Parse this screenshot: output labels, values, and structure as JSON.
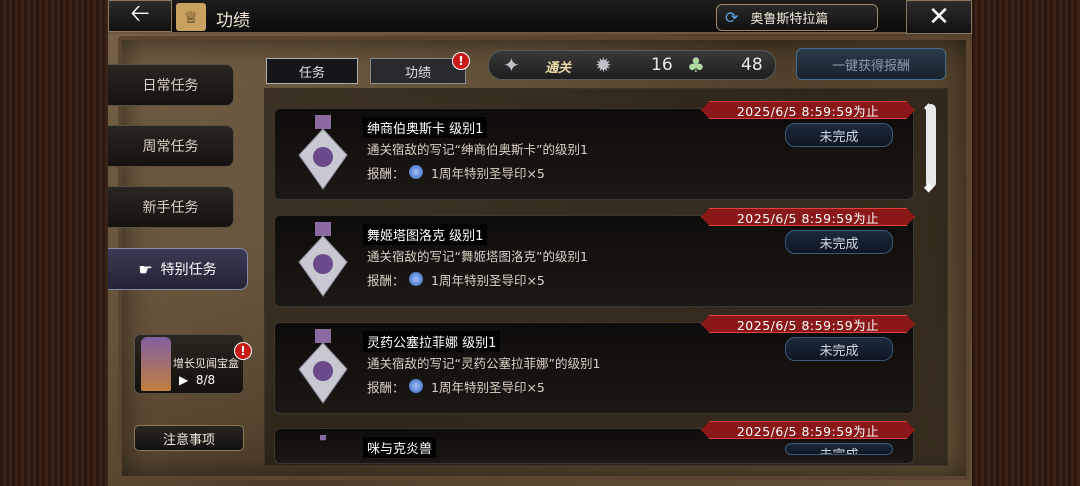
{
  "header": {
    "back_icon": "back-arrow-icon",
    "title": "功绩",
    "chapter": "奥鲁斯特拉篇",
    "close_icon": "close-icon"
  },
  "sidebar": {
    "items": [
      {
        "label": "日常任务"
      },
      {
        "label": "周常任务"
      },
      {
        "label": "新手任务"
      },
      {
        "label": "特别任务",
        "active": true
      }
    ],
    "treasure": {
      "name": "增长见闻宝盒",
      "count": "8/8",
      "alert": "!"
    },
    "notice": "注意事项"
  },
  "tabs": [
    {
      "label": "任务"
    },
    {
      "label": "功绩",
      "alert": "!"
    }
  ],
  "counters": {
    "cleared_label": "通关",
    "silver_count": "16",
    "clover_count": "48"
  },
  "claim_all": "一键获得报酬",
  "missions": [
    {
      "name": "绅商伯奥斯卡  级别1",
      "desc": "通关宿敌的写记“绅商伯奥斯卡”的级别1",
      "reward_label": "报酬：",
      "reward": "1周年特别圣导印×5",
      "deadline": "2025/6/5  8:59:59为止",
      "status": "未完成"
    },
    {
      "name": "舞姬塔图洛克  级别1",
      "desc": "通关宿敌的写记“舞姬塔图洛克”的级别1",
      "reward_label": "报酬：",
      "reward": "1周年特别圣导印×5",
      "deadline": "2025/6/5  8:59:59为止",
      "status": "未完成"
    },
    {
      "name": "灵药公塞拉菲娜  级别1",
      "desc": "通关宿敌的写记“灵药公塞拉菲娜”的级别1",
      "reward_label": "报酬：",
      "reward": "1周年特别圣导印×5",
      "deadline": "2025/6/5  8:59:59为止",
      "status": "未完成"
    },
    {
      "name": "咪与克炎兽",
      "desc": "",
      "reward_label": "",
      "reward": "",
      "deadline": "2025/6/5  8:59:59为止",
      "status": "未完成"
    }
  ]
}
